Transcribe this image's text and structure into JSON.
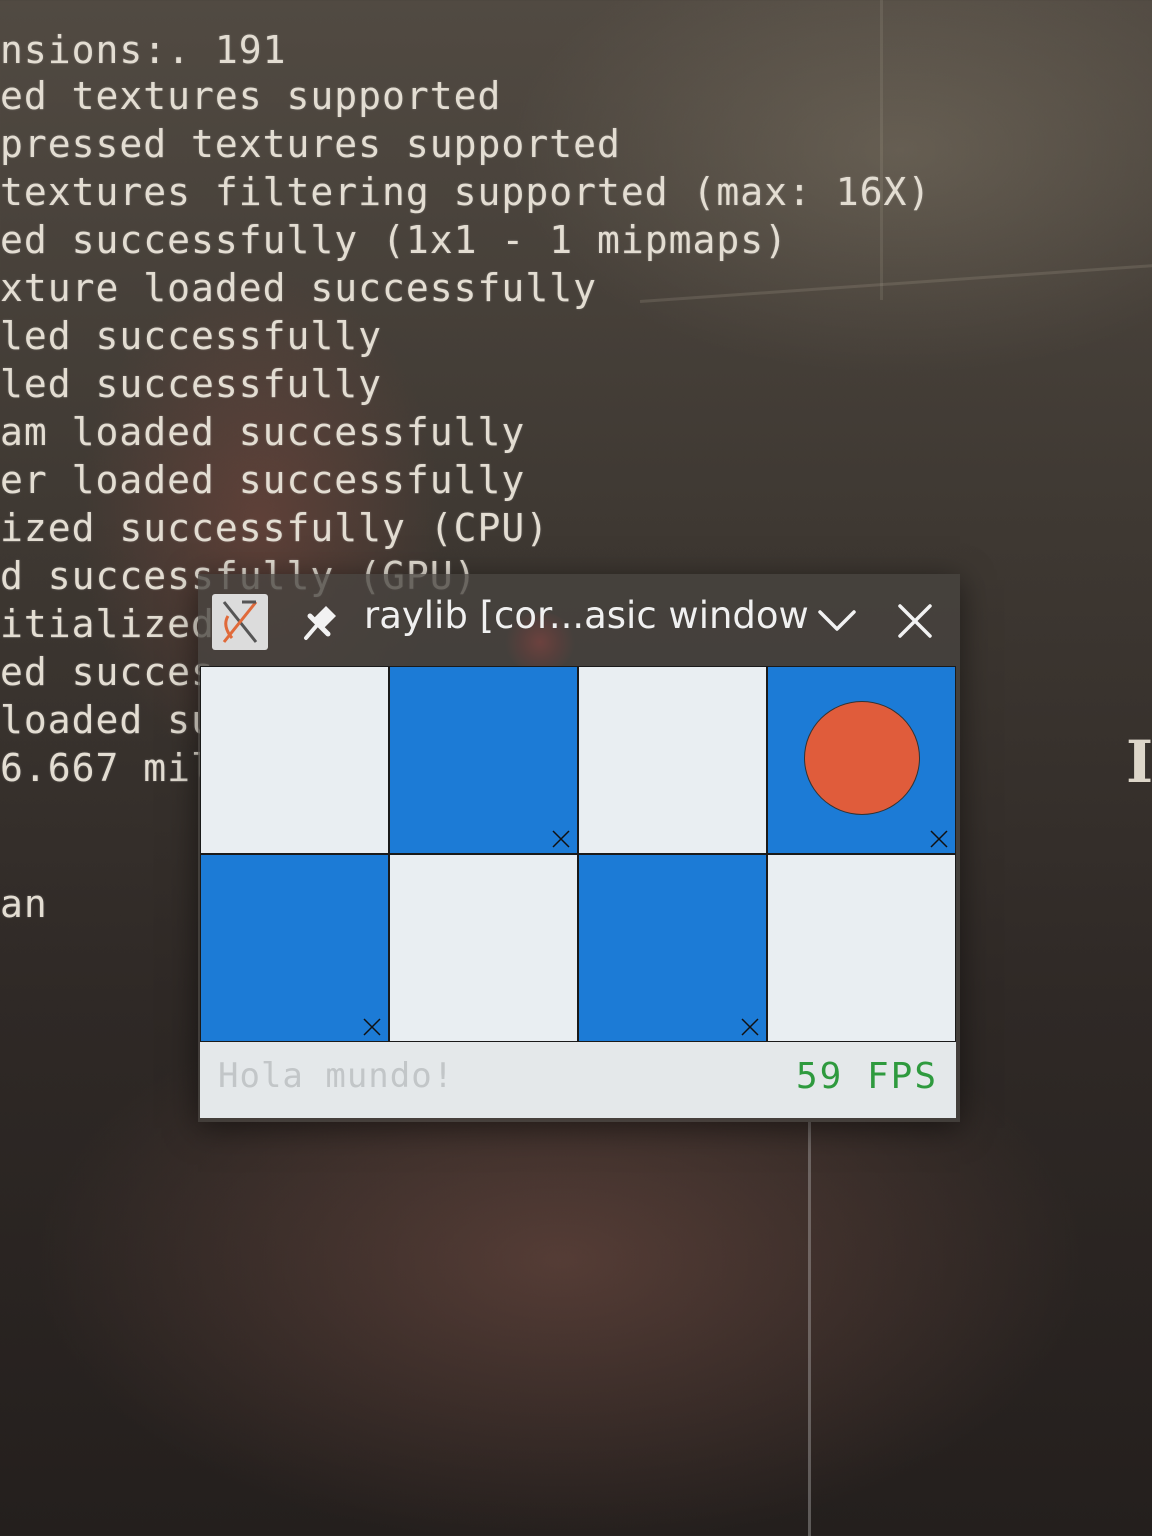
{
  "terminal": {
    "lines": [
      "nsions:. 191",
      "ed textures supported",
      "pressed textures supported",
      "textures filtering supported (max: 16X)",
      "ed successfully (1x1 - 1 mipmaps)",
      "xture loaded successfully",
      "led successfully",
      "led successfully",
      "am loaded successfully",
      "er loaded successfully",
      "ized successfully (CPU)",
      "d successfully (GPU)",
      "itialized",
      "ed succes",
      "loaded su",
      "6.667 mil",
      "",
      "an"
    ]
  },
  "window": {
    "title": "raylib [cor...asic window",
    "app_icon": "x-app-icon",
    "pin_icon": "pin-icon",
    "minimize_icon": "chevron-down-icon",
    "close_icon": "close-icon",
    "grid": {
      "rows": [
        [
          {
            "color": "light",
            "marker": false,
            "ball": false
          },
          {
            "color": "blue",
            "marker": true,
            "ball": false
          },
          {
            "color": "light",
            "marker": false,
            "ball": false
          },
          {
            "color": "blue",
            "marker": true,
            "ball": true
          }
        ],
        [
          {
            "color": "blue",
            "marker": true,
            "ball": false
          },
          {
            "color": "light",
            "marker": false,
            "ball": false
          },
          {
            "color": "blue",
            "marker": true,
            "ball": false
          },
          {
            "color": "light",
            "marker": false,
            "ball": false
          }
        ]
      ],
      "colors": {
        "light": "#e9eef2",
        "blue": "#1c7bd6",
        "ball": "#e05c3b"
      }
    },
    "status": {
      "message": "Hola mundo!",
      "fps": "59 FPS",
      "fps_color": "#2e9a3e"
    }
  }
}
